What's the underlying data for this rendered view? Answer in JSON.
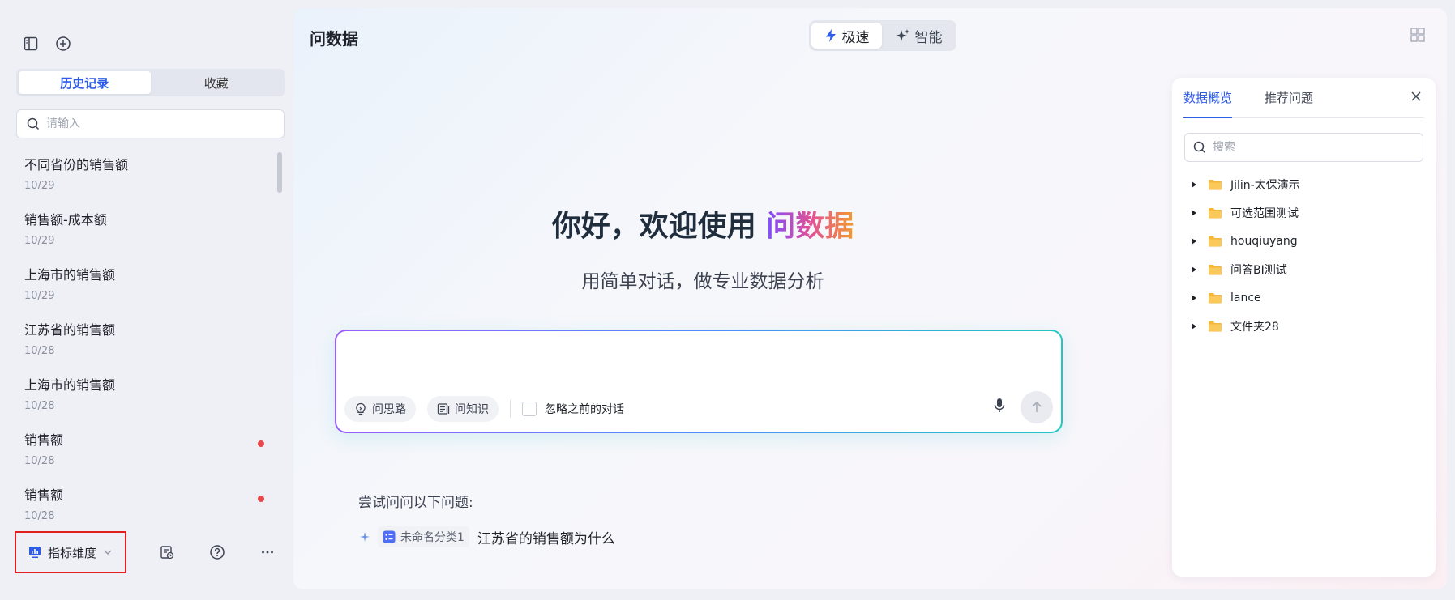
{
  "sidebar": {
    "tabs": [
      {
        "label": "历史记录",
        "active": true
      },
      {
        "label": "收藏",
        "active": false
      }
    ],
    "search_placeholder": "请输入",
    "history": [
      {
        "title": "不同省份的销售额",
        "date": "10/29",
        "unread": false
      },
      {
        "title": "销售额-成本额",
        "date": "10/29",
        "unread": false
      },
      {
        "title": "上海市的销售额",
        "date": "10/29",
        "unread": false
      },
      {
        "title": "江苏省的销售额",
        "date": "10/28",
        "unread": false
      },
      {
        "title": "上海市的销售额",
        "date": "10/28",
        "unread": false
      },
      {
        "title": "销售额",
        "date": "10/28",
        "unread": true
      },
      {
        "title": "销售额",
        "date": "10/28",
        "unread": true
      }
    ],
    "metric_button_label": "指标维度"
  },
  "main": {
    "title": "问数据",
    "modes": [
      {
        "label": "极速",
        "active": true
      },
      {
        "label": "智能",
        "active": false
      }
    ],
    "hero_prefix": "你好，欢迎使用 ",
    "hero_accent": "问数据",
    "hero_subtitle": "用简单对话，做专业数据分析",
    "chips": {
      "thinking": "问思路",
      "knowledge": "问知识"
    },
    "ignore_label": "忽略之前的对话",
    "try_label": "尝试问问以下问题:",
    "suggestion": {
      "tag": "未命名分类1",
      "text": "江苏省的销售额为什么"
    }
  },
  "panel": {
    "tabs": [
      {
        "label": "数据概览",
        "active": true
      },
      {
        "label": "推荐问题",
        "active": false
      }
    ],
    "search_placeholder": "搜索",
    "folders": [
      "Jilin-太保演示",
      "可选范围测试",
      "houqiuyang",
      "问答BI测试",
      "lance",
      "文件夹28"
    ]
  },
  "colors": {
    "accent": "#2e5ce6",
    "unread_dot": "#e5484d",
    "highlight_border": "#e0201c",
    "folder": "#f5b73b"
  }
}
